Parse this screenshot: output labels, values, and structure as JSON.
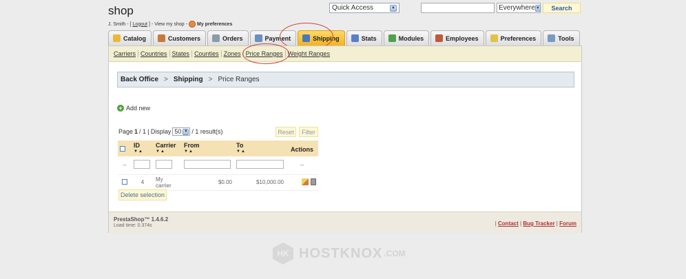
{
  "header": {
    "shop_name": "shop",
    "user_name": "J. Smith",
    "logout": "Logout",
    "view_shop": "View my shop",
    "preferences": "My preferences",
    "quick_access": "Quick Access",
    "search_scope": "Everywhere",
    "search_button": "Search",
    "search_value": ""
  },
  "tabs": [
    {
      "label": "Catalog",
      "icon": "folder-icon",
      "color": "#e8b93b"
    },
    {
      "label": "Customers",
      "icon": "user-icon",
      "color": "#c77a3c"
    },
    {
      "label": "Orders",
      "icon": "cart-icon",
      "color": "#8d9aa8"
    },
    {
      "label": "Payment",
      "icon": "payment-icon",
      "color": "#6a8fc0"
    },
    {
      "label": "Shipping",
      "icon": "truck-icon",
      "color": "#4a78c0",
      "active": true
    },
    {
      "label": "Stats",
      "icon": "chart-icon",
      "color": "#5a7fc7"
    },
    {
      "label": "Modules",
      "icon": "puzzle-icon",
      "color": "#4ea24a"
    },
    {
      "label": "Employees",
      "icon": "employees-icon",
      "color": "#c05a3a"
    },
    {
      "label": "Preferences",
      "icon": "preferences-icon",
      "color": "#e2c24a"
    },
    {
      "label": "Tools",
      "icon": "tools-icon",
      "color": "#7a9ac0"
    }
  ],
  "subnav": [
    "Carriers",
    "Countries",
    "States",
    "Counties",
    "Zones",
    "Price Ranges",
    "Weight Ranges"
  ],
  "breadcrumb": {
    "root": "Back Office",
    "section": "Shipping",
    "current": "Price Ranges"
  },
  "add_new": "Add new",
  "list": {
    "page_label": "Page",
    "page_current": "1",
    "page_total": "/ 1",
    "display_label": "| Display",
    "display_value": "50",
    "results": "/ 1 result(s)",
    "reset": "Reset",
    "filter": "Filter",
    "columns": [
      "ID",
      "Carrier",
      "From",
      "To",
      "Actions"
    ],
    "filter_placeholder": "--",
    "rows": [
      {
        "id": "4",
        "carrier": "My carrier",
        "from": "$0.00",
        "to": "$10,000.00"
      }
    ],
    "delete_selection": "Delete selection"
  },
  "footer": {
    "version": "PrestaShop™ 1.4.6.2",
    "load_time": "Load time: 0.374s",
    "contact": "Contact",
    "bug_tracker": "Bug Tracker",
    "forum": "Forum"
  },
  "watermark": {
    "logo": "HK",
    "text": "HOSTKNOX",
    "domain": ".COM"
  }
}
